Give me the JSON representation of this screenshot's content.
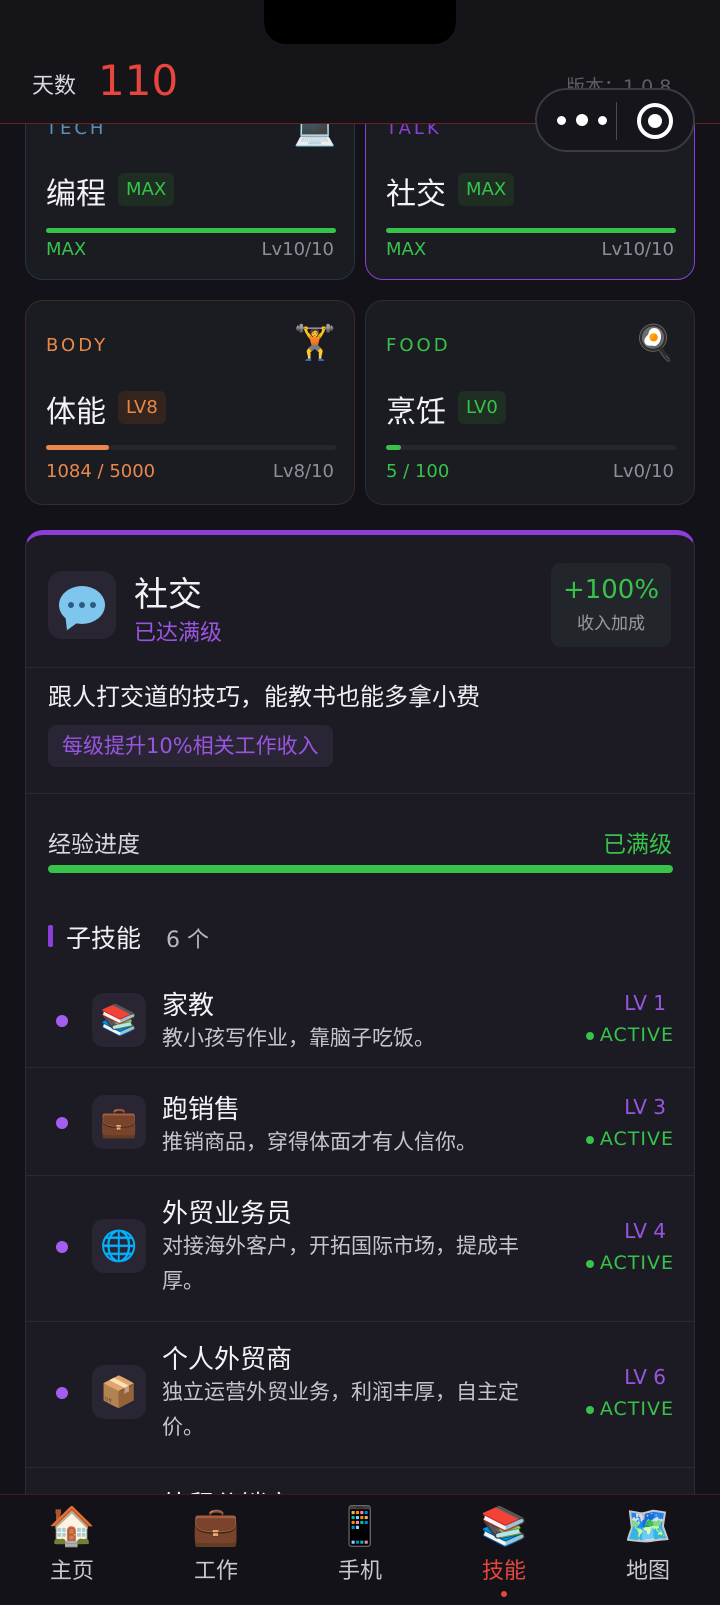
{
  "header": {
    "day_label": "天数",
    "day_value": "110",
    "version": "版本：1.0.8"
  },
  "cards": [
    {
      "category": "TECH",
      "icon": "💻",
      "name": "编程",
      "badge": "MAX",
      "progress_left": "MAX",
      "progress_right": "Lv10/10",
      "fill": 1.0,
      "accent": "#37c24a",
      "category_color": "#5a8fb8"
    },
    {
      "category": "TALK",
      "icon": "💬",
      "name": "社交",
      "badge": "MAX",
      "progress_left": "MAX",
      "progress_right": "Lv10/10",
      "fill": 1.0,
      "accent": "#37c24a",
      "category_color": "#8b3fd9"
    },
    {
      "category": "BODY",
      "icon": "🏋️",
      "name": "体能",
      "badge": "LV8",
      "progress_left": "1084 / 5000",
      "progress_right": "Lv8/10",
      "fill": 0.2168,
      "accent": "#e8894a",
      "category_color": "#e8894a"
    },
    {
      "category": "FOOD",
      "icon": "🍳",
      "name": "烹饪",
      "badge": "LV0",
      "progress_left": "5 / 100",
      "progress_right": "Lv0/10",
      "fill": 0.05,
      "accent": "#37c24a",
      "category_color": "#37c24a"
    }
  ],
  "detail": {
    "title": "社交",
    "status": "已达满级",
    "bonus_value": "+100%",
    "bonus_label": "收入加成",
    "description": "跟人打交道的技巧，能教书也能多拿小费",
    "tag": "每级提升10%相关工作收入",
    "exp_label": "经验进度",
    "exp_status": "已满级",
    "exp_fill": 1.0,
    "subskills_title": "子技能",
    "subskills_count": "6 个",
    "subskills": [
      {
        "icon": "📚",
        "title": "家教",
        "desc": "教小孩写作业，靠脑子吃饭。",
        "level": "LV 1",
        "status": "ACTIVE"
      },
      {
        "icon": "💼",
        "title": "跑销售",
        "desc": "推销商品，穿得体面才有人信你。",
        "level": "LV 3",
        "status": "ACTIVE"
      },
      {
        "icon": "🌐",
        "title": "外贸业务员",
        "desc": "对接海外客户，开拓国际市场，提成丰厚。",
        "level": "LV 4",
        "status": "ACTIVE"
      },
      {
        "icon": "📦",
        "title": "个人外贸商",
        "desc": "独立运营外贸业务，利润丰厚，自主定价。",
        "level": "LV 6",
        "status": "ACTIVE"
      },
      {
        "icon": "",
        "title": "外贸分销商",
        "desc": "",
        "level": "",
        "status": ""
      }
    ]
  },
  "tabs": [
    {
      "icon": "🏠",
      "label": "主页",
      "active": false
    },
    {
      "icon": "💼",
      "label": "工作",
      "active": false
    },
    {
      "icon": "📱",
      "label": "手机",
      "active": false
    },
    {
      "icon": "📚",
      "label": "技能",
      "active": true
    },
    {
      "icon": "🗺️",
      "label": "地图",
      "active": false
    }
  ]
}
